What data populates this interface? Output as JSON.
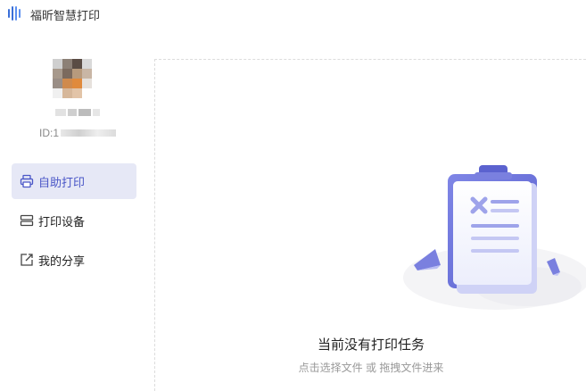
{
  "app": {
    "title": "福昕智慧打印"
  },
  "user": {
    "id_prefix": "ID:1"
  },
  "nav": {
    "items": [
      {
        "label": "自助打印",
        "icon": "printer-icon",
        "active": true
      },
      {
        "label": "打印设备",
        "icon": "device-list-icon",
        "active": false
      },
      {
        "label": "我的分享",
        "icon": "share-icon",
        "active": false
      }
    ]
  },
  "empty_state": {
    "title": "当前没有打印任务",
    "hint": "点击选择文件 或 拖拽文件进来"
  },
  "colors": {
    "accent": "#4a56c7",
    "active_bg": "#e6e8f6",
    "illustration": "#7b82e0"
  }
}
